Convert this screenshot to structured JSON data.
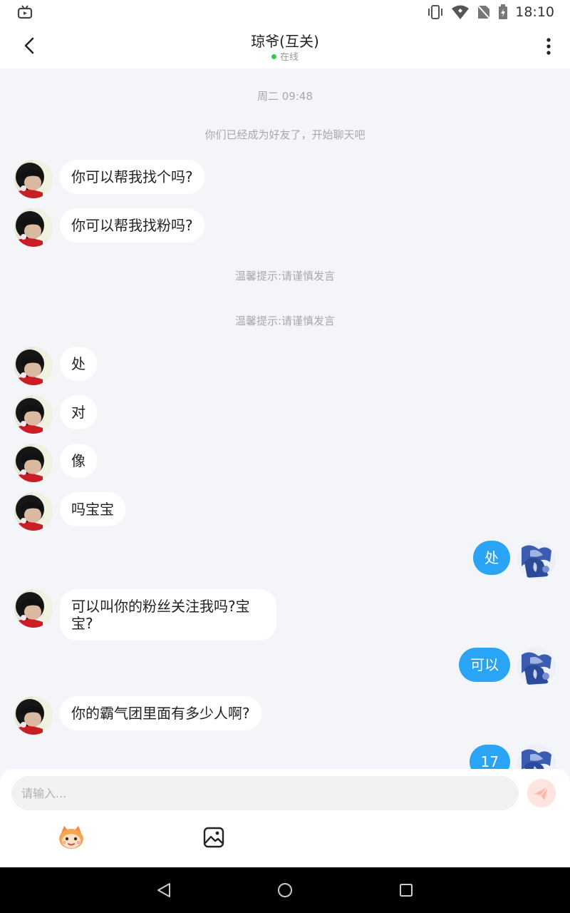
{
  "status_bar": {
    "time": "18:10"
  },
  "header": {
    "title": "琼爷(互关)",
    "status": "在线"
  },
  "messages": [
    {
      "kind": "system",
      "text": "周二 09:48"
    },
    {
      "kind": "system",
      "text": "你们已经成为好友了，开始聊天吧"
    },
    {
      "kind": "in",
      "text": "你可以帮我找个吗?"
    },
    {
      "kind": "in",
      "text": "你可以帮我找粉吗?"
    },
    {
      "kind": "system",
      "text": "温馨提示:请谨慎发言"
    },
    {
      "kind": "system",
      "text": "温馨提示:请谨慎发言"
    },
    {
      "kind": "in",
      "text": "处"
    },
    {
      "kind": "in",
      "text": "对"
    },
    {
      "kind": "in",
      "text": "像"
    },
    {
      "kind": "in",
      "text": "吗宝宝"
    },
    {
      "kind": "out",
      "text": "处"
    },
    {
      "kind": "in",
      "text": "可以叫你的粉丝关注我吗?宝宝?"
    },
    {
      "kind": "out",
      "text": "可以"
    },
    {
      "kind": "in",
      "text": "你的霸气团里面有多少人啊?"
    },
    {
      "kind": "out",
      "text": "17"
    }
  ],
  "composer": {
    "placeholder": "请输入..."
  },
  "icons": {
    "back": "back-arrow-icon",
    "more": "more-vertical-icon",
    "send": "send-icon",
    "emoji": "emoji-icon",
    "image": "image-icon"
  },
  "colors": {
    "outgoing_bubble": "#2aa4f4",
    "online": "#2ecc40",
    "send_button": "#fde4df"
  }
}
